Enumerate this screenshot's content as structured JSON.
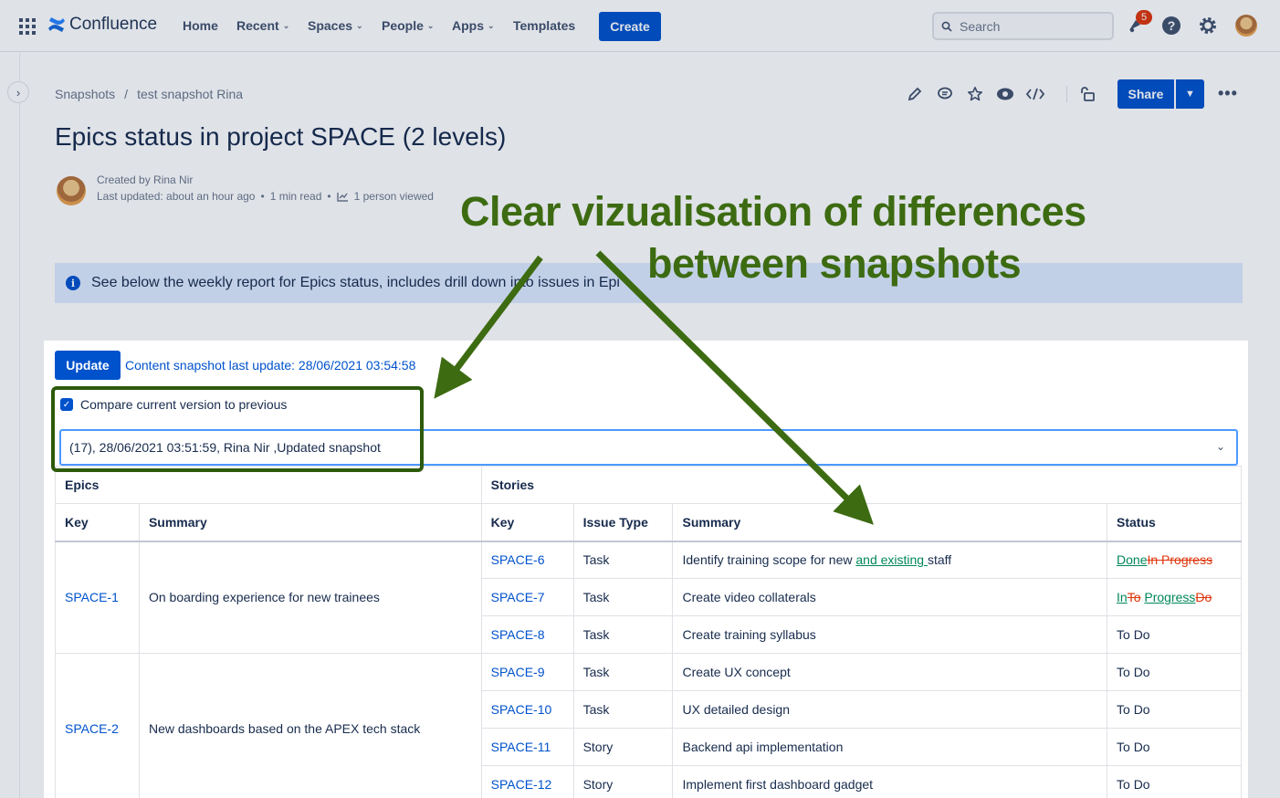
{
  "topnav": {
    "brand": "Confluence",
    "items": [
      {
        "label": "Home",
        "has_chevron": false
      },
      {
        "label": "Recent",
        "has_chevron": true
      },
      {
        "label": "Spaces",
        "has_chevron": true
      },
      {
        "label": "People",
        "has_chevron": true
      },
      {
        "label": "Apps",
        "has_chevron": true
      },
      {
        "label": "Templates",
        "has_chevron": false
      }
    ],
    "create_label": "Create",
    "search_placeholder": "Search",
    "notification_count": "5",
    "icons": [
      "apps-grid-icon",
      "confluence-logo-icon",
      "search-icon",
      "notification-icon",
      "help-icon",
      "settings-icon",
      "user-avatar"
    ]
  },
  "breadcrumb": [
    "Snapshots",
    "test snapshot Rina"
  ],
  "breadcrumb_separator": "/",
  "page_actions": {
    "icons": [
      "edit-icon",
      "comment-icon",
      "star-icon",
      "watch-icon",
      "embed-code-icon",
      "restrictions-icon"
    ],
    "share_label": "Share"
  },
  "page": {
    "title": "Epics status in project SPACE (2 levels)",
    "created_by": "Created by Rina Nir",
    "last_updated": "Last updated: about an hour ago",
    "read_time": "1 min read",
    "views": "1 person viewed",
    "info_text": "See below the weekly report for Epics status, includes drill down into issues in Epi"
  },
  "macro": {
    "update_label": "Update",
    "snapshot_text": "Content snapshot last update: 28/06/2021 03:54:58",
    "compare_label": "Compare current version to previous",
    "compare_checked": true,
    "version_selected": "(17), 28/06/2021 03:51:59, Rina Nir ,Updated snapshot"
  },
  "table": {
    "group_headers": [
      "Epics",
      "Stories"
    ],
    "columns": [
      "Key",
      "Summary",
      "Key",
      "Issue Type",
      "Summary",
      "Status"
    ],
    "epics": [
      {
        "key": "SPACE-1",
        "summary": "On boarding experience for new trainees",
        "stories": [
          {
            "key": "SPACE-6",
            "type": "Task",
            "summary": [
              {
                "t": "Identify training scope for new "
              },
              {
                "t": "and existing ",
                "ins": true
              },
              {
                "t": "staff"
              }
            ],
            "status": [
              {
                "t": "Done",
                "ins": true
              },
              {
                "t": "In Progress",
                "del": true
              }
            ]
          },
          {
            "key": "SPACE-7",
            "type": "Task",
            "summary": [
              {
                "t": "Create video collaterals"
              }
            ],
            "status": [
              {
                "t": "In",
                "ins": true
              },
              {
                "t": "To",
                "del": true
              },
              {
                "t": " "
              },
              {
                "t": "Progress",
                "ins": true
              },
              {
                "t": "Do",
                "del": true
              }
            ]
          },
          {
            "key": "SPACE-8",
            "type": "Task",
            "summary": [
              {
                "t": "Create training syllabus"
              }
            ],
            "status": [
              {
                "t": "To Do"
              }
            ]
          }
        ]
      },
      {
        "key": "SPACE-2",
        "summary": "New dashboards based on the APEX tech stack",
        "stories": [
          {
            "key": "SPACE-9",
            "type": "Task",
            "summary": [
              {
                "t": "Create UX concept"
              }
            ],
            "status": [
              {
                "t": "To Do"
              }
            ]
          },
          {
            "key": "SPACE-10",
            "type": "Task",
            "summary": [
              {
                "t": "UX detailed design"
              }
            ],
            "status": [
              {
                "t": "To Do"
              }
            ]
          },
          {
            "key": "SPACE-11",
            "type": "Story",
            "summary": [
              {
                "t": "Backend api implementation"
              }
            ],
            "status": [
              {
                "t": "To Do"
              }
            ]
          },
          {
            "key": "SPACE-12",
            "type": "Story",
            "summary": [
              {
                "t": "Implement first dashboard gadget"
              }
            ],
            "status": [
              {
                "t": "To Do"
              }
            ]
          }
        ]
      }
    ]
  },
  "annotation": {
    "line1": "Clear vizualisation of differences",
    "line2": "between snapshots",
    "color": "#3d6b12"
  },
  "colors": {
    "primary": "#0052cc",
    "inserted": "#00875a",
    "deleted": "#de350b",
    "info_bg": "#deebff"
  }
}
